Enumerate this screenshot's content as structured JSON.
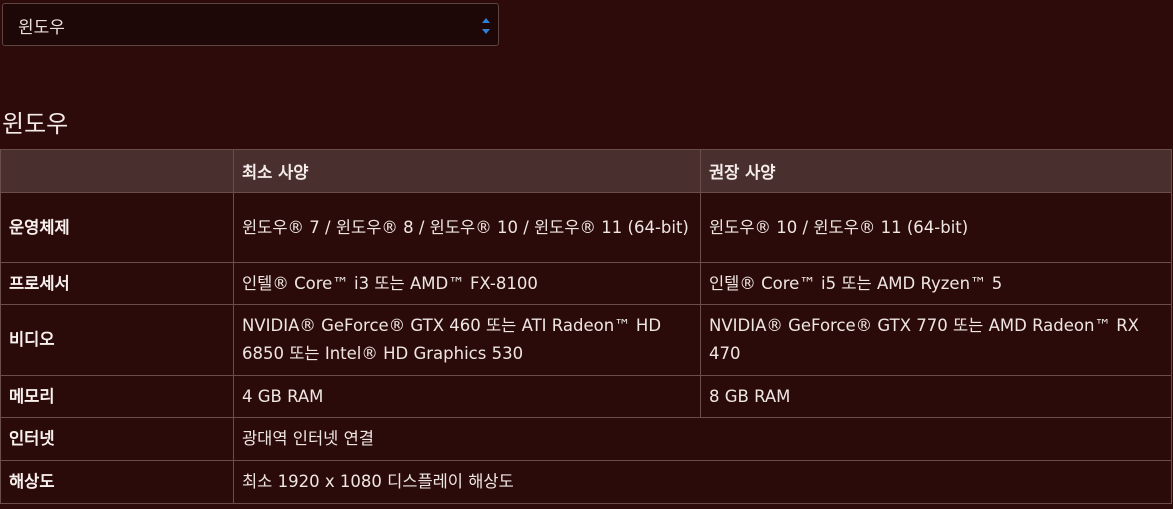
{
  "platform_select": {
    "selected": "윈도우",
    "arrows_icon": "sort-arrows-icon"
  },
  "section_title": "윈도우",
  "table": {
    "headers": [
      "",
      "최소 사양",
      "권장 사양"
    ],
    "rows": [
      {
        "label": "운영체제",
        "min": "윈도우® 7 / 윈도우® 8 / 윈도우® 10 / 윈도우® 11 (64-bit)",
        "rec": "윈도우® 10 / 윈도우® 11 (64-bit)",
        "height": 70
      },
      {
        "label": "프로세서",
        "min": "인텔® Core™ i3 또는 AMD™ FX-8100",
        "rec": "인텔® Core™ i5 또는 AMD Ryzen™ 5",
        "height": 42
      },
      {
        "label": "비디오",
        "min": "NVIDIA® GeForce® GTX 460 또는 ATI Radeon™ HD 6850 또는 Intel® HD Graphics 530",
        "rec": "NVIDIA® GeForce® GTX 770 또는 AMD Radeon™ RX 470",
        "height": 71
      },
      {
        "label": "메모리",
        "min": "4 GB RAM",
        "rec": "8 GB RAM",
        "height": 42
      },
      {
        "label": "인터넷",
        "value": "광대역 인터넷 연결",
        "height": 43
      },
      {
        "label": "해상도",
        "value": "최소 1920 x 1080 디스플레이 해상도",
        "height": 43
      }
    ]
  },
  "colors": {
    "background": "#2e0b0b",
    "header_row": "#4a2f2f",
    "border": "#6a4e4b",
    "select_arrow": "#2f7fd4"
  }
}
